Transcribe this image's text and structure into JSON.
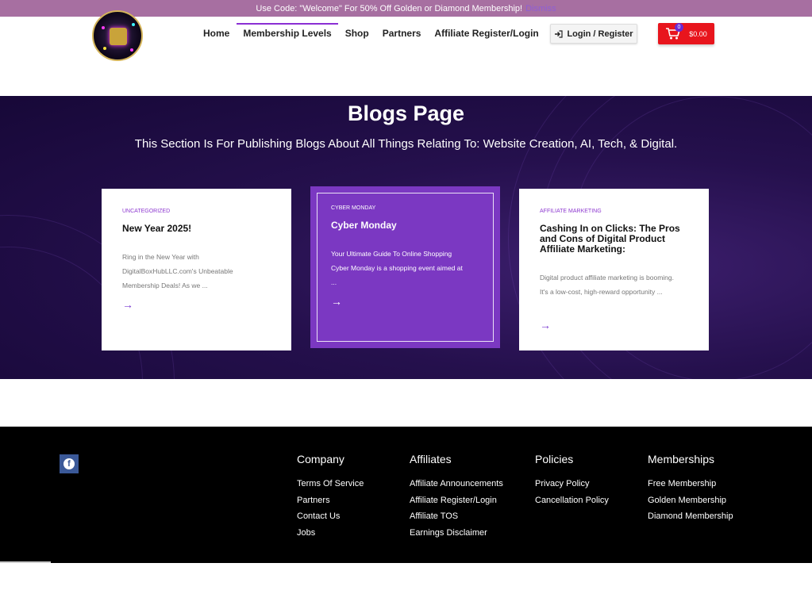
{
  "promo": {
    "text": "Use Code: \"Welcome\" For 50% Off Golden or Diamond Membership!",
    "dismiss": "Dismiss"
  },
  "nav": {
    "items": [
      {
        "label": "Home"
      },
      {
        "label": "Membership Levels"
      },
      {
        "label": "Shop"
      },
      {
        "label": "Partners"
      },
      {
        "label": "Affiliate Register/Login"
      }
    ],
    "login": "Login / Register",
    "cart_total": "$0.00",
    "cart_count": "0"
  },
  "hero": {
    "title": "Blogs Page",
    "subtitle": "This Section Is For Publishing Blogs About All Things Relating To: Website Creation, AI, Tech, & Digital."
  },
  "posts": [
    {
      "category": "UNCATEGORIZED",
      "title": "New Year 2025!",
      "excerpt": "Ring in the New Year with DigitalBoxHubLLC.com's Unbeatable Membership Deals! As we ..."
    },
    {
      "category": "CYBER MONDAY",
      "title": "Cyber Monday",
      "excerpt": "Your Ultimate Guide To Online Shopping Cyber Monday is a shopping event aimed at ..."
    },
    {
      "category": "AFFILIATE MARKETING",
      "title": "Cashing In on Clicks: The Pros and Cons of Digital Product Affiliate Marketing:",
      "excerpt": "Digital product affiliate marketing is booming. It's a low-cost, high-reward opportunity ..."
    }
  ],
  "footer": {
    "columns": [
      {
        "heading": "Company",
        "links": [
          "Terms Of Service",
          "Partners",
          "Contact Us",
          "Jobs"
        ]
      },
      {
        "heading": "Affiliates",
        "links": [
          "Affiliate Announcements",
          "Affiliate Register/Login",
          "Affiliate TOS",
          "Earnings Disclaimer"
        ]
      },
      {
        "heading": "Policies",
        "links": [
          "Privacy Policy",
          "Cancellation Policy"
        ]
      },
      {
        "heading": "Memberships",
        "links": [
          "Free Membership",
          "Golden Membership",
          "Diamond Membership"
        ]
      }
    ]
  },
  "icons": {
    "login": "login-arrow-icon",
    "cart": "shopping-cart-icon",
    "post_arrow": "arrow-right-icon",
    "social": "facebook-icon"
  },
  "colors": {
    "promo_bg": "#a76fa1",
    "accent": "#8b2fd4",
    "cart_red": "#e8151d",
    "hero_bg": "#25104d",
    "featured_card": "#7b38c2",
    "footer_bg": "#000000"
  }
}
